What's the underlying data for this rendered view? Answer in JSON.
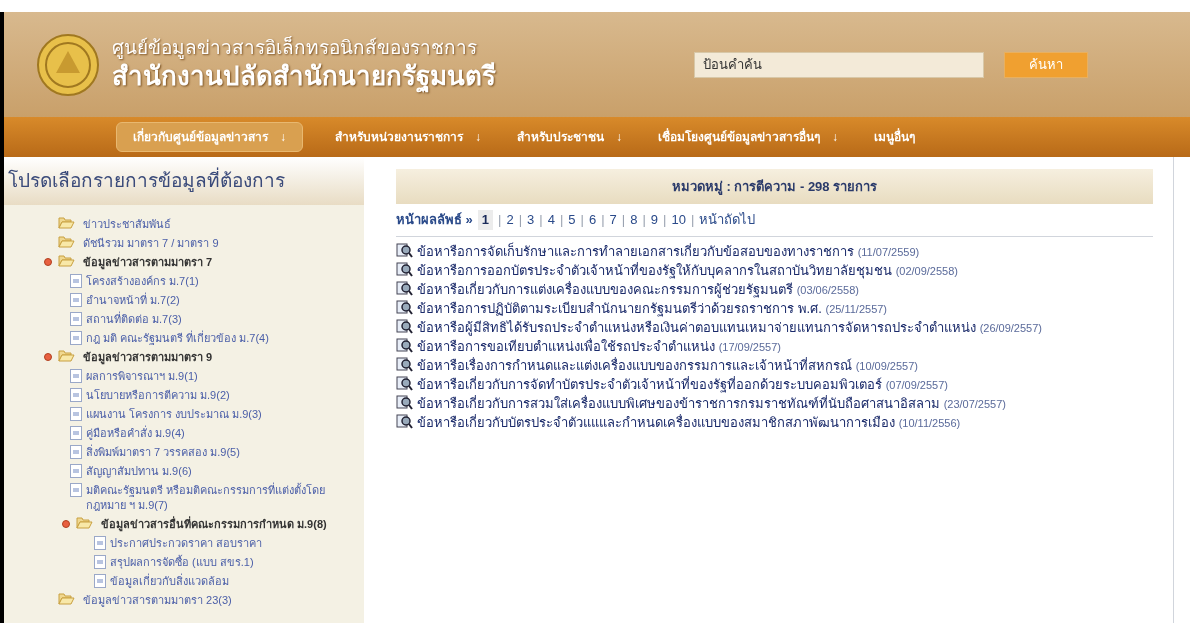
{
  "header": {
    "title_line_1": "ศูนย์ข้อมูลข่าวสารอิเล็กทรอนิกส์ของราชการ",
    "title_line_2": "สำนักงานปลัดสำนักนายกรัฐมนตรี",
    "search": {
      "placeholder": "ป้อนคำค้น",
      "button": "ค้นหา"
    }
  },
  "nav": [
    {
      "label": "เกี่ยวกับศูนย์ข้อมูลข่าวสาร",
      "arrow": "↓",
      "selected": true
    },
    {
      "label": "สำหรับหน่วยงานราชการ",
      "arrow": "↓",
      "selected": false
    },
    {
      "label": "สำหรับประชาชน",
      "arrow": "↓",
      "selected": false
    },
    {
      "label": "เชื่อมโยงศูนย์ข้อมูลข่าวสารอื่นๆ",
      "arrow": "↓",
      "selected": false
    },
    {
      "label": "เมนูอื่นๆ",
      "selected": false
    }
  ],
  "sidebar": {
    "title": "โปรดเลือกรายการข้อมูลที่ต้องการ",
    "items": [
      {
        "kind": "folder",
        "label": "ข่าวประชาสัมพันธ์",
        "expanded": false
      },
      {
        "kind": "folder",
        "label": "ดัชนีรวม มาตรา 7 / มาตรา 9",
        "expanded": false
      },
      {
        "kind": "folder",
        "label": "ข้อมูลข่าวสารตามมาตรา 7",
        "expanded": true,
        "children": [
          {
            "kind": "page",
            "label": "โครงสร้างองค์กร ม.7(1)"
          },
          {
            "kind": "page",
            "label": "อำนาจหน้าที่ ม.7(2)"
          },
          {
            "kind": "page",
            "label": "สถานที่ติดต่อ ม.7(3)"
          },
          {
            "kind": "page",
            "label": "กฎ มติ คณะรัฐมนตรี ที่เกี่ยวข้อง ม.7(4)"
          }
        ]
      },
      {
        "kind": "folder",
        "label": "ข้อมูลข่าวสารตามมาตรา 9",
        "expanded": true,
        "children": [
          {
            "kind": "page",
            "label": "ผลการพิจารณาฯ ม.9(1)"
          },
          {
            "kind": "page",
            "label": "นโยบายหรือการตีความ ม.9(2)"
          },
          {
            "kind": "page",
            "label": "แผนงาน โครงการ งบประมาณ ม.9(3)"
          },
          {
            "kind": "page",
            "label": "คู่มือหรือคำสั่ง ม.9(4)"
          },
          {
            "kind": "page",
            "label": "สิ่งพิมพ์มาตรา 7 วรรคสอง ม.9(5)"
          },
          {
            "kind": "page",
            "label": "สัญญาสัมปทาน ม.9(6)"
          },
          {
            "kind": "page",
            "label": "มติคณะรัฐมนตรี หรือมติคณะกรรมการที่แต่งตั้งโดยกฎหมาย ฯ ม.9(7)"
          },
          {
            "kind": "folder",
            "label": "ข้อมูลข่าวสารอื่นที่คณะกรรมการกำหนด ม.9(8)",
            "expanded": true,
            "children": [
              {
                "kind": "page",
                "label": "ประกาศประกวดราคา สอบราคา"
              },
              {
                "kind": "page",
                "label": "สรุปผลการจัดซื้อ (แบบ สขร.1)"
              },
              {
                "kind": "page",
                "label": "ข้อมูลเกี่ยวกับสิ่งแวดล้อม"
              }
            ]
          }
        ]
      },
      {
        "kind": "folder",
        "label": "ข้อมูลข่าวสารตามมาตรา 23(3)",
        "expanded": false
      }
    ]
  },
  "main": {
    "category_heading": "หมวดหมู่ : การตีความ - 298 รายการ",
    "pagination": {
      "label": "หน้าผลลัพธ์ »",
      "pages": [
        {
          "label": "1",
          "selected": true
        },
        {
          "label": "2",
          "selected": false
        },
        {
          "label": "3",
          "selected": false
        },
        {
          "label": "4",
          "selected": false
        },
        {
          "label": "5",
          "selected": false
        },
        {
          "label": "6",
          "selected": false
        },
        {
          "label": "7",
          "selected": false
        },
        {
          "label": "8",
          "selected": false
        },
        {
          "label": "9",
          "selected": false
        },
        {
          "label": "10",
          "selected": false
        }
      ],
      "separator": "|",
      "next": "หน้าถัดไป"
    },
    "results": [
      {
        "title": "ข้อหารือการจัดเก็บรักษาและการทำลายเอกสารเกี่ยวกับข้อสอบของทางราชการ",
        "date": "(11/07/2559)"
      },
      {
        "title": "ข้อหารือการออกบัตรประจำตัวเจ้าหน้าที่ของรัฐให้กับบุคลากรในสถาบันวิทยาลัยชุมชน",
        "date": "(02/09/2558)"
      },
      {
        "title": "ข้อหารือเกี่ยวกับการแต่งเครื่องแบบของคณะกรรมการผู้ช่วยรัฐมนตรี",
        "date": "(03/06/2558)"
      },
      {
        "title": "ข้อหารือการปฏิบัติตามระเบียบสำนักนายกรัฐมนตรีว่าด้วยรถราชการ พ.ศ.",
        "date": "(25/11/2557)"
      },
      {
        "title": "ข้อหารือผู้มีสิทธิได้รับรถประจำตำแหน่งหรือเงินค่าตอบแทนเหมาจ่ายแทนการจัดหารถประจำตำแหน่ง",
        "date": "(26/09/2557)"
      },
      {
        "title": "ข้อหารือการขอเทียบตำแหน่งเพื่อใช้รถประจำตำแหน่ง",
        "date": "(17/09/2557)"
      },
      {
        "title": "ข้อหารือเรื่องการกำหนดและแต่งเครื่องแบบของกรรมการและเจ้าหน้าที่สหกรณ์",
        "date": "(10/09/2557)"
      },
      {
        "title": "ข้อหารือเกี่ยวกับการจัดทำบัตรประจำตัวเจ้าหน้าที่ของรัฐที่ออกด้วยระบบคอมพิวเตอร์",
        "date": "(07/09/2557)"
      },
      {
        "title": "ข้อหารือเกี่ยวกับการสวมใส่เครื่องแบบพิเศษของข้าราชการกรมราชทัณฑ์ที่นับถือศาสนาอิสลาม",
        "date": "(23/07/2557)"
      },
      {
        "title": "ข้อหารือเกี่ยวกับบัตรประจำตัวแแและกำหนดเครื่องแบบของสมาชิกสภาพัฒนาการเมือง",
        "date": "(10/11/2556)"
      }
    ]
  }
}
